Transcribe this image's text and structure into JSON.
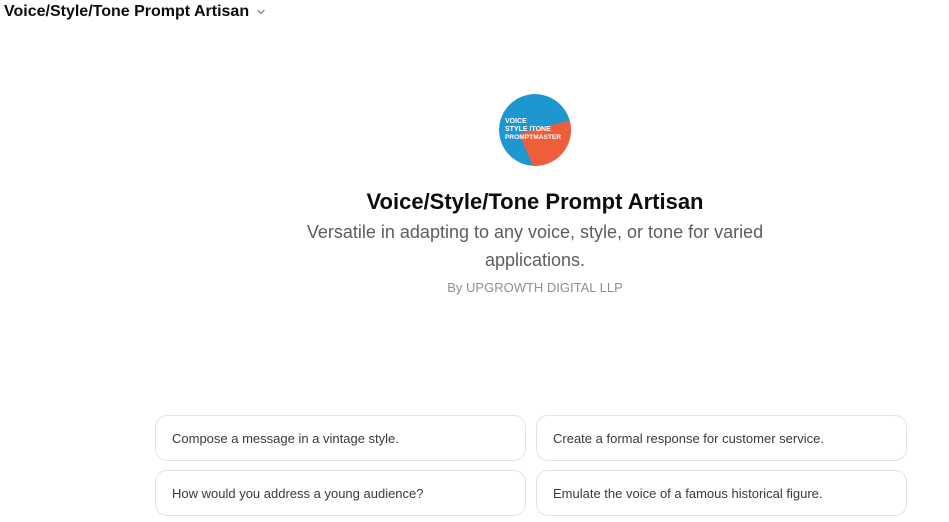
{
  "header": {
    "title": "Voice/Style/Tone Prompt Artisan",
    "dropdown_icon": "chevron-down-icon"
  },
  "gpt": {
    "logo": {
      "line1": "VOICE",
      "line2": "STYLE /TONE",
      "line3": "PROMPTMASTER",
      "colors": {
        "blue": "#1E96D0",
        "orange": "#EE5E3A"
      }
    },
    "name": "Voice/Style/Tone Prompt Artisan",
    "description": "Versatile in adapting to any voice, style, or tone for varied applications.",
    "author": "By UPGROWTH DIGITAL LLP"
  },
  "starters": [
    "Compose a message in a vintage style.",
    "Create a formal response for customer service.",
    "How would you address a young audience?",
    "Emulate the voice of a famous historical figure."
  ]
}
